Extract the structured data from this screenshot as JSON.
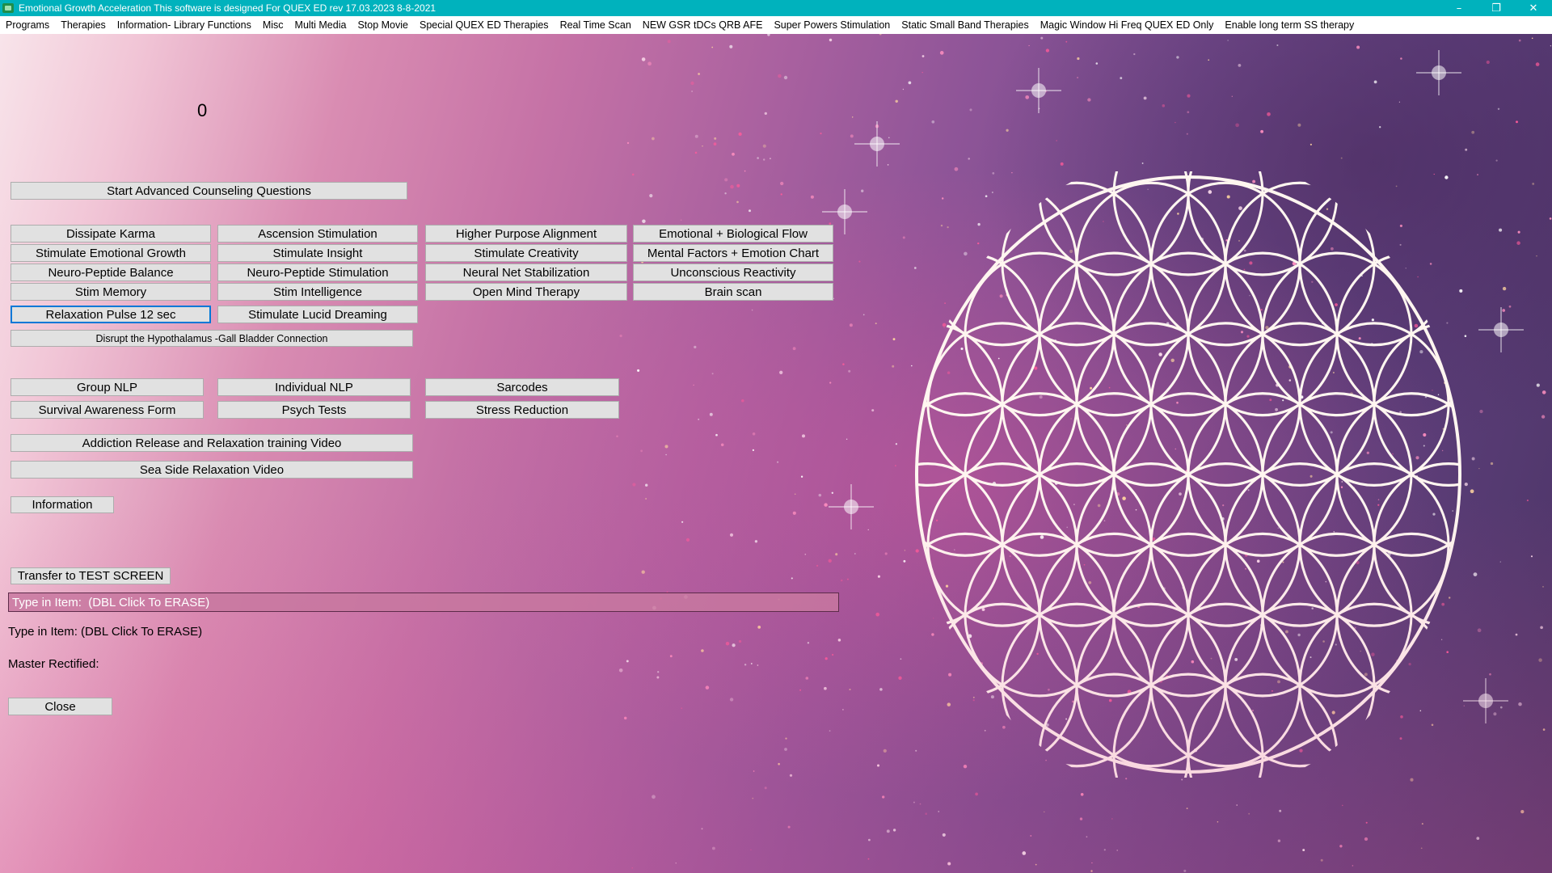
{
  "window": {
    "title": "Emotional Growth Acceleration   This software is designed For QUEX ED rev 17.03.2023 8-8-2021",
    "controls": {
      "minimize": "–",
      "maximize": "❐",
      "close": "✕"
    }
  },
  "menu": [
    "Programs",
    "Therapies",
    "Information- Library Functions",
    "Misc",
    "Multi Media",
    "Stop Movie",
    "Special QUEX ED Therapies",
    "Real Time Scan",
    "NEW GSR tDCs QRB AFE",
    "Super Powers Stimulation",
    "Static Small Band Therapies",
    "Magic Window Hi Freq QUEX ED Only",
    "Enable long term SS therapy"
  ],
  "counter": "0",
  "buttons": {
    "start_counseling": "Start Advanced Counseling Questions",
    "grid": [
      [
        "Dissipate Karma",
        "Ascension Stimulation",
        "Higher Purpose Alignment",
        "Emotional + Biological Flow"
      ],
      [
        "Stimulate Emotional Growth",
        "Stimulate Insight",
        "Stimulate Creativity",
        "Mental Factors + Emotion Chart"
      ],
      [
        "Neuro-Peptide Balance",
        "Neuro-Peptide Stimulation",
        "Neural Net Stabilization",
        "Unconscious Reactivity"
      ],
      [
        "Stim Memory",
        "Stim Intelligence",
        "Open Mind Therapy",
        "Brain scan"
      ],
      [
        "Relaxation Pulse 12 sec",
        "Stimulate Lucid Dreaming"
      ]
    ],
    "disrupt": "Disrupt  the Hypothalamus -Gall Bladder Connection",
    "nlp": [
      [
        "Group NLP",
        "Individual NLP",
        "Sarcodes"
      ],
      [
        "Survival Awareness Form",
        "Psych Tests",
        "Stress Reduction"
      ]
    ],
    "addiction_video": "Addiction Release and Relaxation training Video",
    "seaside_video": "Sea Side Relaxation Video",
    "information": "Information",
    "transfer": "Transfer to TEST SCREEN",
    "close": "Close"
  },
  "item_input": {
    "value": "Type in Item:  (DBL Click To ERASE)"
  },
  "labels": {
    "type_in_item": "Type in Item:  (DBL Click To ERASE)",
    "master_rectified": "Master Rectified:"
  }
}
